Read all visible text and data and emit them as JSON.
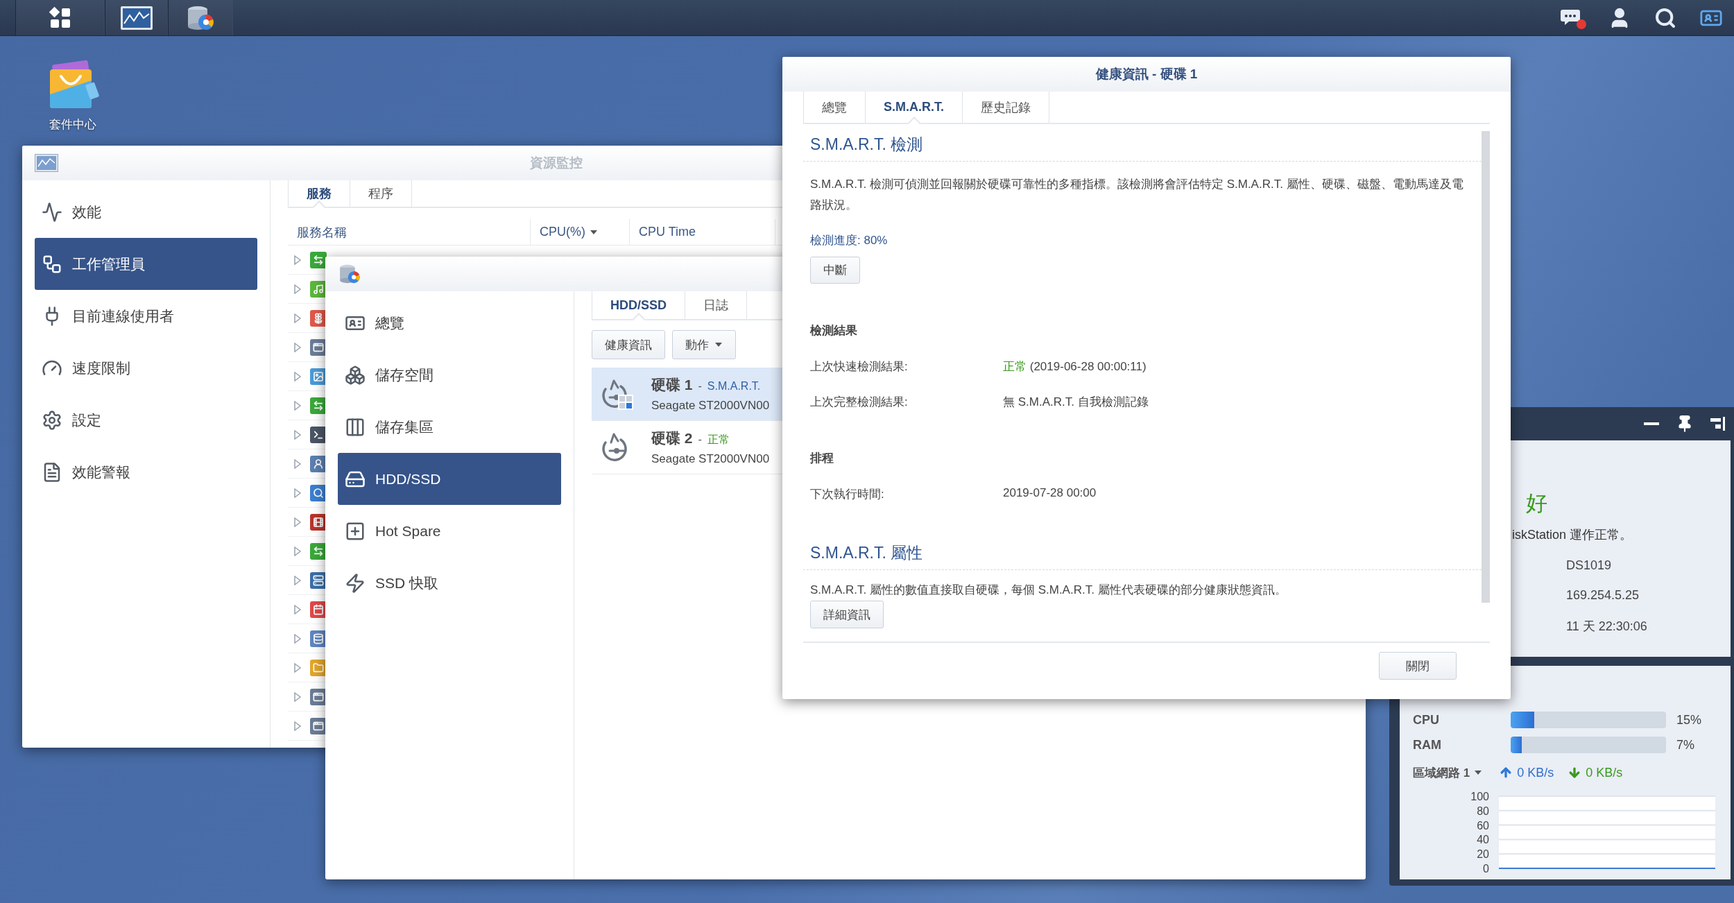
{
  "taskbar": {
    "chat_unread": true
  },
  "desktop_icons": [
    {
      "label": "套件中心"
    }
  ],
  "resource_monitor": {
    "title": "資源監控",
    "sidebar": [
      {
        "label": "效能",
        "selected": false
      },
      {
        "label": "工作管理員",
        "selected": true
      },
      {
        "label": "目前連線使用者",
        "selected": false
      },
      {
        "label": "速度限制",
        "selected": false
      },
      {
        "label": "設定",
        "selected": false
      },
      {
        "label": "效能警報",
        "selected": false
      }
    ],
    "tabs": [
      {
        "label": "服務",
        "selected": true
      },
      {
        "label": "程序",
        "selected": false
      }
    ],
    "columns": [
      {
        "label": "服務名稱",
        "sorted": false
      },
      {
        "label": "CPU(%)",
        "sorted": true
      },
      {
        "label": "CPU Time",
        "sorted": false
      }
    ],
    "rows": [
      {
        "expanded": false
      },
      {
        "expanded": false
      },
      {
        "expanded": false
      },
      {
        "expanded": false
      },
      {
        "expanded": false
      },
      {
        "expanded": false
      },
      {
        "expanded": false
      },
      {
        "expanded": false
      },
      {
        "expanded": false
      },
      {
        "expanded": false
      },
      {
        "expanded": false
      },
      {
        "expanded": false
      },
      {
        "expanded": false
      },
      {
        "expanded": false
      },
      {
        "expanded": false
      },
      {
        "expanded": false
      },
      {
        "expanded": false
      }
    ]
  },
  "storage_manager": {
    "sidebar": [
      {
        "label": "總覽",
        "selected": false
      },
      {
        "label": "儲存空間",
        "selected": false
      },
      {
        "label": "儲存集區",
        "selected": false
      },
      {
        "label": "HDD/SSD",
        "selected": true
      },
      {
        "label": "Hot Spare",
        "selected": false
      },
      {
        "label": "SSD 快取",
        "selected": false
      }
    ],
    "tabs": [
      {
        "label": "HDD/SSD",
        "selected": true
      },
      {
        "label": "日誌",
        "selected": false
      }
    ],
    "buttons": [
      {
        "label": "健康資訊",
        "dropdown": false
      },
      {
        "label": "動作",
        "dropdown": true
      }
    ],
    "disks": [
      {
        "name": "硬碟 1",
        "separator": "-",
        "status": "S.M.A.R.T.",
        "color": "#2e5fa3",
        "badge": true,
        "model": "Seagate ST2000VN00",
        "selected": true
      },
      {
        "name": "硬碟 2",
        "separator": "-",
        "status": "正常",
        "color": "#3a9a1e",
        "badge": false,
        "model": "Seagate ST2000VN00",
        "selected": false
      }
    ]
  },
  "dialog": {
    "title": "健康資訊 - 硬碟 1",
    "tabs": [
      {
        "label": "總覽",
        "selected": false
      },
      {
        "label": "S.M.A.R.T.",
        "selected": true
      },
      {
        "label": "歷史記錄",
        "selected": false
      }
    ],
    "smart_test": {
      "heading": "S.M.A.R.T. 檢測",
      "description": "S.M.A.R.T. 檢測可偵測並回報關於硬碟可靠性的多種指標。該檢測將會評估特定 S.M.A.R.T. 屬性、硬碟、磁盤、電動馬達及電路狀況。",
      "progress": "檢測進度: 80%",
      "button": "中斷"
    },
    "results": {
      "heading": "檢測結果",
      "rows": [
        {
          "label": "上次快速檢測結果:",
          "status": "正常",
          "value": "(2019-06-28 00:00:11)"
        },
        {
          "label": "上次完整檢測結果:",
          "value": "無 S.M.A.R.T. 自我檢測記錄"
        }
      ]
    },
    "schedule": {
      "heading": "排程",
      "rows": [
        {
          "label": "下次執行時間:",
          "value": "2019-07-28 00:00"
        }
      ]
    },
    "attributes": {
      "heading": "S.M.A.R.T. 屬性",
      "description": "S.M.A.R.T. 屬性的數值直接取自硬碟，每個 S.M.A.R.T. 屬性代表硬碟的部分健康狀態資訊。",
      "button": "詳細資訊"
    },
    "close_button": "關閉"
  },
  "widget": {
    "health": {
      "status": "好",
      "message": "iskStation 運作正常。",
      "values": [
        "DS1019",
        "169.254.5.25",
        "11 天 22:30:06"
      ]
    },
    "resources": {
      "meters": [
        {
          "label": "CPU",
          "level": 0.15,
          "reading": "15%"
        },
        {
          "label": "RAM",
          "level": 0.07,
          "reading": "7%"
        }
      ],
      "network": {
        "label": "區域網路 1",
        "upload": "0 KB/s",
        "download": "0 KB/s"
      },
      "chart_data": {
        "type": "line",
        "grid": true,
        "ylim": [
          0,
          100
        ],
        "yticks": [
          0,
          20,
          40,
          60,
          80,
          100
        ],
        "series": [
          {
            "color": "#3a7bd5",
            "values": [
              0,
              0,
              0,
              0,
              0,
              0,
              0,
              0,
              0,
              0,
              0,
              0
            ]
          }
        ]
      }
    }
  }
}
